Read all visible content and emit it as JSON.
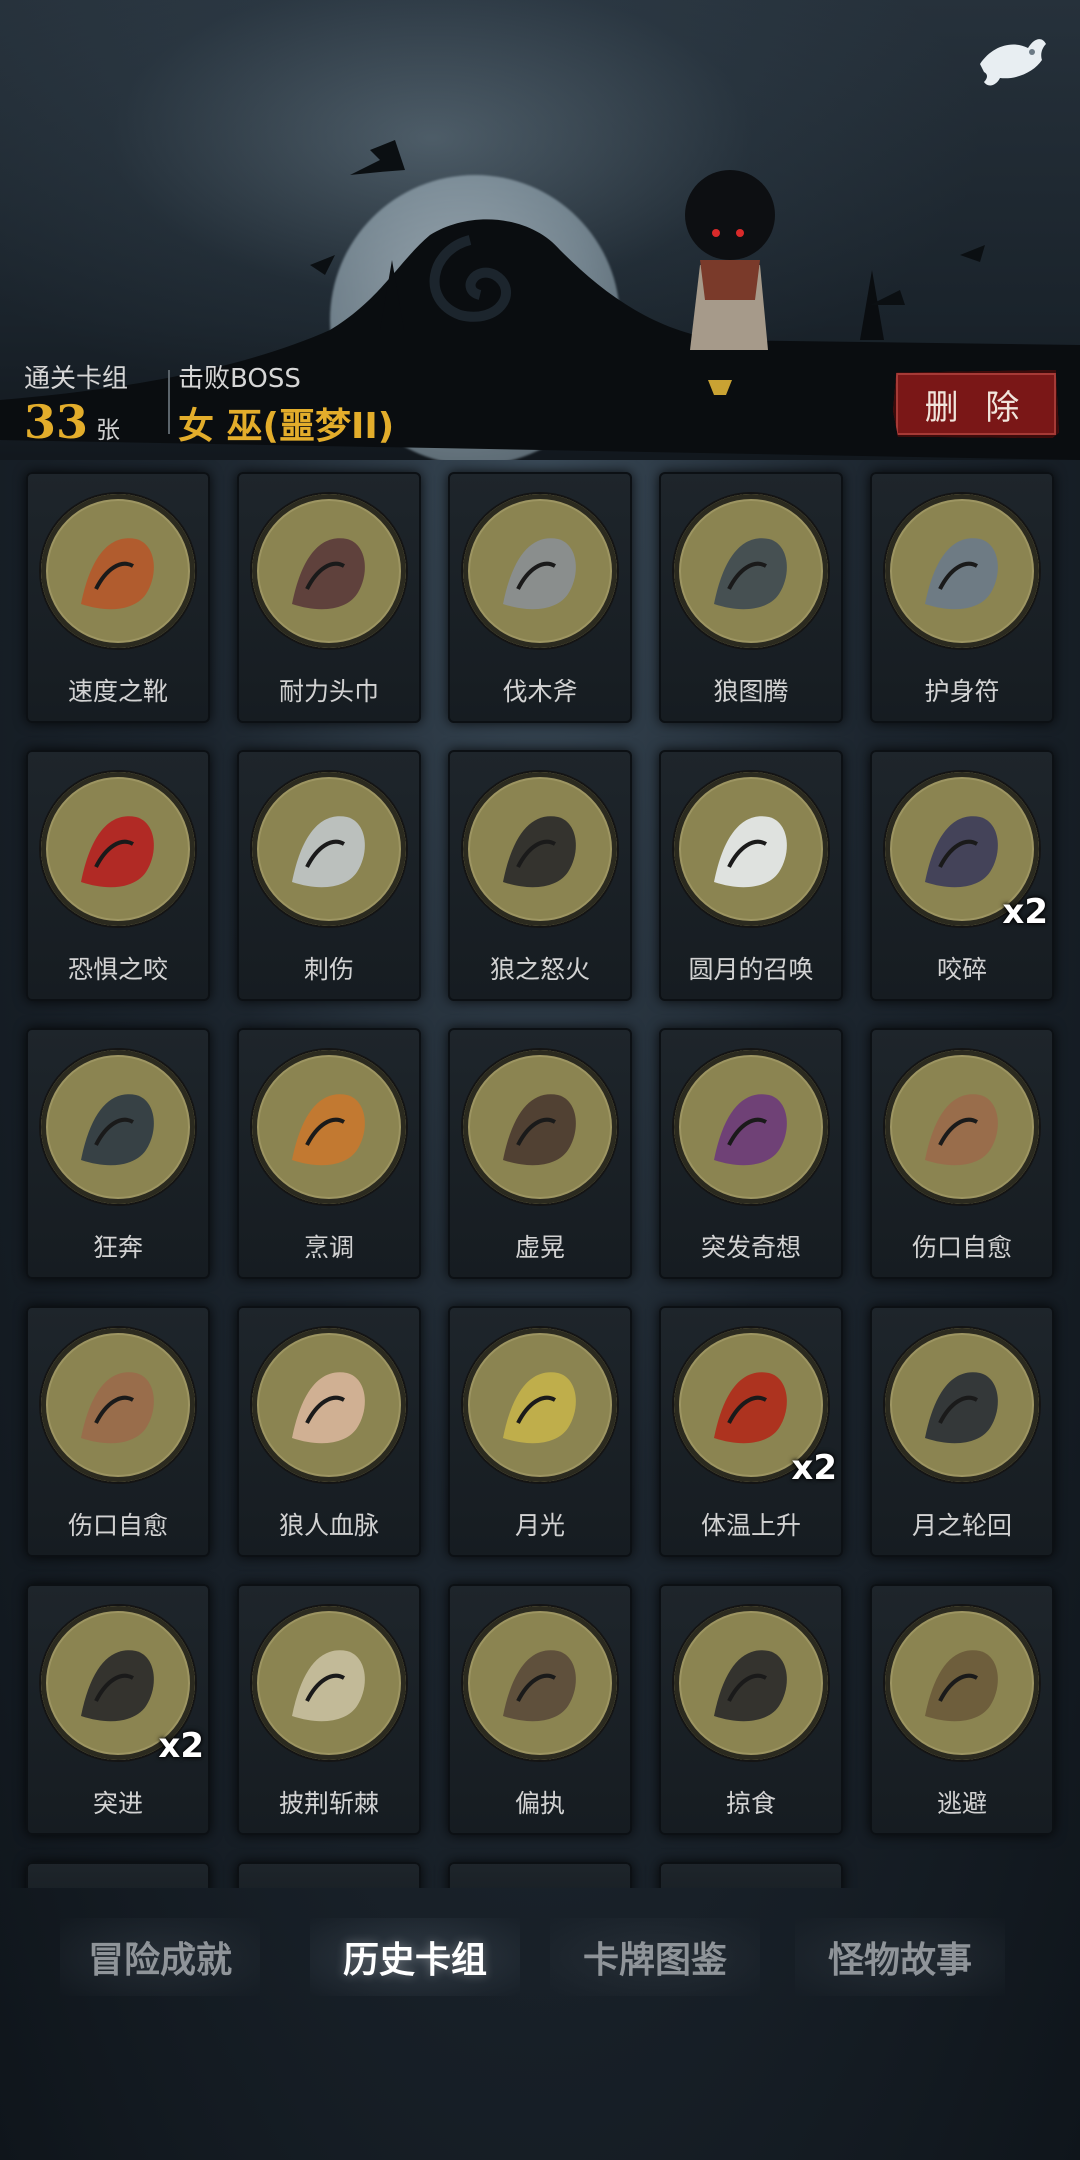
{
  "header": {
    "deck_count_label": "通关卡组",
    "deck_count": "33",
    "deck_count_unit": "张",
    "boss_label": "击败BOSS",
    "boss_name": "女 巫(噩梦II)",
    "delete_label": "删 除"
  },
  "cards": [
    {
      "name": "速度之靴",
      "icon": "boot-icon"
    },
    {
      "name": "耐力头巾",
      "icon": "headband-icon"
    },
    {
      "name": "伐木斧",
      "icon": "axe-icon"
    },
    {
      "name": "狼图腾",
      "icon": "wolf-totem-icon"
    },
    {
      "name": "护身符",
      "icon": "amulet-icon"
    },
    {
      "name": "恐惧之咬",
      "icon": "fear-bite-icon"
    },
    {
      "name": "刺伤",
      "icon": "dagger-icon"
    },
    {
      "name": "狼之怒火",
      "icon": "wolf-fury-icon"
    },
    {
      "name": "圆月的召唤",
      "icon": "full-moon-forest-icon"
    },
    {
      "name": "咬碎",
      "icon": "crush-bite-icon",
      "multiplier": "x2"
    },
    {
      "name": "狂奔",
      "icon": "running-wolf-icon"
    },
    {
      "name": "烹调",
      "icon": "fox-cook-icon"
    },
    {
      "name": "虚晃",
      "icon": "boxer-icon"
    },
    {
      "name": "突发奇想",
      "icon": "idea-icon"
    },
    {
      "name": "伤口自愈",
      "icon": "heal-wound-icon"
    },
    {
      "name": "伤口自愈",
      "icon": "heal-wound-icon"
    },
    {
      "name": "狼人血脉",
      "icon": "werewolf-hand-icon"
    },
    {
      "name": "月光",
      "icon": "moonlight-icon"
    },
    {
      "name": "体温上升",
      "icon": "fire-wolf-icon",
      "multiplier": "x2"
    },
    {
      "name": "月之轮回",
      "icon": "moon-phases-icon"
    },
    {
      "name": "突进",
      "icon": "lunge-icon",
      "multiplier": "x2"
    },
    {
      "name": "披荆斩棘",
      "icon": "thorn-cut-icon"
    },
    {
      "name": "偏执",
      "icon": "wolf-bear-icon"
    },
    {
      "name": "掠食",
      "icon": "predator-icon"
    },
    {
      "name": "逃避",
      "icon": "escape-icon"
    }
  ],
  "tabs": [
    {
      "label": "冒险成就",
      "active": false
    },
    {
      "label": "历史卡组",
      "active": true
    },
    {
      "label": "卡牌图鉴",
      "active": false
    },
    {
      "label": "怪物故事",
      "active": false
    }
  ]
}
